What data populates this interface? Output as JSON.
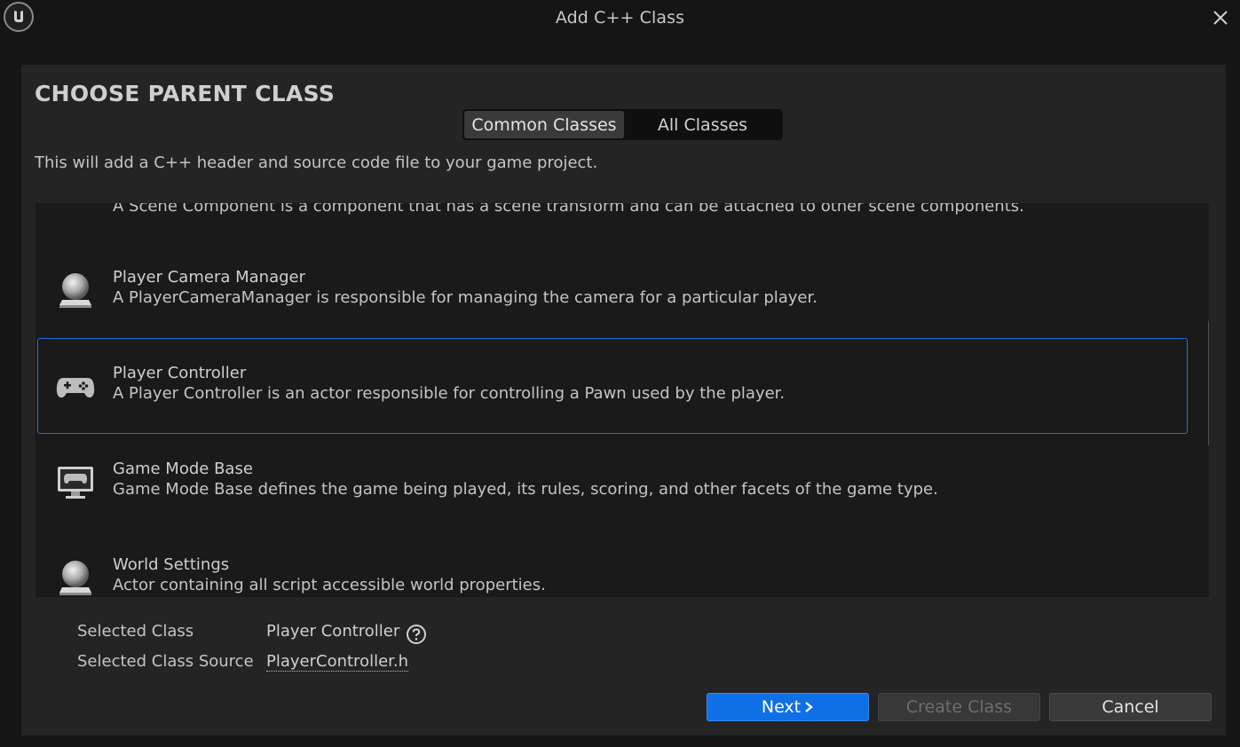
{
  "window": {
    "title": "Add C++ Class"
  },
  "page": {
    "heading": "CHOOSE PARENT CLASS",
    "description": "This will add a C++ header and source code file to your game project."
  },
  "tabs": [
    {
      "label": "Common Classes",
      "active": true
    },
    {
      "label": "All Classes",
      "active": false
    }
  ],
  "class_list": [
    {
      "name": "",
      "description": "A Scene Component is a component that has a scene transform and can be attached to other scene components.",
      "icon": "scene-component-icon",
      "selected": false
    },
    {
      "name": "Player Camera Manager",
      "description": "A PlayerCameraManager is responsible for managing the camera for a particular player.",
      "icon": "actor-sphere-icon",
      "selected": false
    },
    {
      "name": "Player Controller",
      "description": "A Player Controller is an actor responsible for controlling a Pawn used by the player.",
      "icon": "gamepad-icon",
      "selected": true
    },
    {
      "name": "Game Mode Base",
      "description": "Game Mode Base defines the game being played, its rules, scoring, and other facets of the game type.",
      "icon": "game-monitor-icon",
      "selected": false
    },
    {
      "name": "World Settings",
      "description": "Actor containing all script accessible world properties.",
      "icon": "actor-sphere-icon",
      "selected": false
    }
  ],
  "selection": {
    "class_label": "Selected Class",
    "class_value": "Player Controller",
    "source_label": "Selected Class Source",
    "source_value": "PlayerController.h"
  },
  "buttons": {
    "next": "Next",
    "create": "Create Class",
    "cancel": "Cancel"
  },
  "colors": {
    "accent": "#0f6fe6",
    "selection_border": "#1f74d6",
    "panel_bg": "#242424",
    "list_bg": "#1a1a1a"
  }
}
